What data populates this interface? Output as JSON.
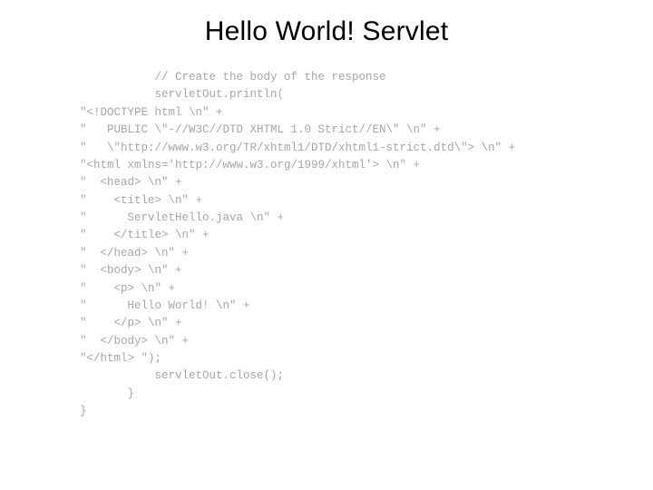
{
  "title": "Hello World! Servlet",
  "code_lines": [
    "           // Create the body of the response",
    "           servletOut.println(",
    "\"<!DOCTYPE html \\n\" +",
    "\"   PUBLIC \\\"-//W3C//DTD XHTML 1.0 Strict//EN\\\" \\n\" +",
    "\"   \\\"http://www.w3.org/TR/xhtml1/DTD/xhtml1-strict.dtd\\\"> \\n\" +",
    "\"<html xmlns='http://www.w3.org/1999/xhtml'> \\n\" +",
    "\"  <head> \\n\" +",
    "\"    <title> \\n\" +",
    "\"      ServletHello.java \\n\" +",
    "\"    </title> \\n\" +",
    "\"  </head> \\n\" +",
    "\"  <body> \\n\" +",
    "\"    <p> \\n\" +",
    "\"      Hello World! \\n\" +",
    "\"    </p> \\n\" +",
    "\"  </body> \\n\" +",
    "\"</html> \");",
    "           servletOut.close();",
    "       }",
    "}"
  ]
}
